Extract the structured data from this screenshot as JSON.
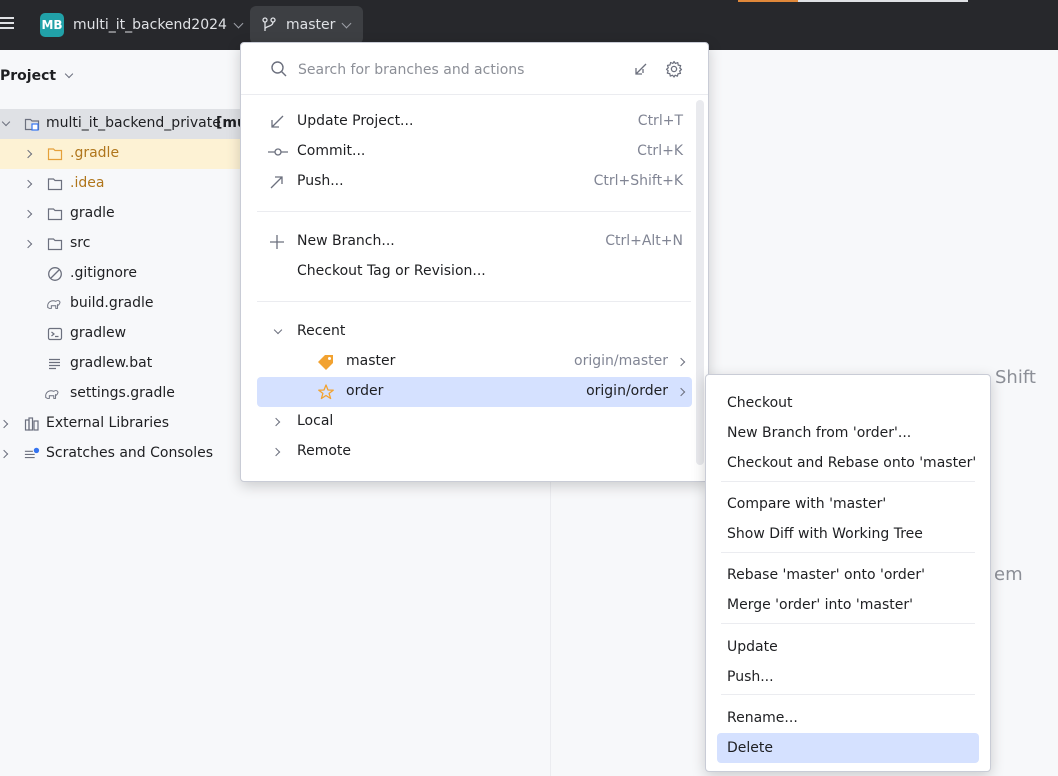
{
  "titlebar": {
    "project_badge": "MB",
    "project_name": "multi_it_backend2024",
    "branch": "master"
  },
  "project_panel": {
    "header": "Project",
    "tree": [
      {
        "label": "multi_it_backend_private",
        "suffix": "[mu",
        "type": "module",
        "expanded": true
      },
      {
        "label": ".gradle",
        "type": "folder-orange",
        "expanded": false
      },
      {
        "label": ".idea",
        "type": "folder",
        "expanded": false
      },
      {
        "label": "gradle",
        "type": "folder",
        "expanded": false
      },
      {
        "label": "src",
        "type": "folder",
        "expanded": false
      },
      {
        "label": ".gitignore",
        "type": "ignore-file"
      },
      {
        "label": "build.gradle",
        "type": "gradle-file"
      },
      {
        "label": "gradlew",
        "type": "shell-file"
      },
      {
        "label": "gradlew.bat",
        "type": "text-file"
      },
      {
        "label": "settings.gradle",
        "type": "gradle-file"
      },
      {
        "label": "External Libraries",
        "type": "library",
        "expanded": false
      },
      {
        "label": "Scratches and Consoles",
        "type": "scratches",
        "expanded": false
      }
    ]
  },
  "background_hints": {
    "hint1": "Shift",
    "hint2": "em"
  },
  "branch_popup": {
    "search_placeholder": "Search for branches and actions",
    "actions": [
      {
        "label": "Update Project...",
        "shortcut": "Ctrl+T",
        "icon": "update-arrow-icon"
      },
      {
        "label": "Commit...",
        "shortcut": "Ctrl+K",
        "icon": "commit-icon"
      },
      {
        "label": "Push...",
        "shortcut": "Ctrl+Shift+K",
        "icon": "push-arrow-icon"
      }
    ],
    "branch_actions": [
      {
        "label": "New Branch...",
        "shortcut": "Ctrl+Alt+N",
        "icon": "plus-icon"
      },
      {
        "label": "Checkout Tag or Revision...",
        "shortcut": ""
      }
    ],
    "groups": {
      "recent": "Recent",
      "local": "Local",
      "remote": "Remote"
    },
    "recent_branches": [
      {
        "name": "master",
        "remote": "origin/master",
        "icon": "tag-icon"
      },
      {
        "name": "order",
        "remote": "origin/order",
        "icon": "star-icon"
      }
    ]
  },
  "context_menu": {
    "items": [
      "Checkout",
      "New Branch from 'order'...",
      "Checkout and Rebase onto 'master'",
      "Compare with 'master'",
      "Show Diff with Working Tree",
      "Rebase 'master' onto 'order'",
      "Merge 'order' into 'master'",
      "Update",
      "Push...",
      "Rename...",
      "Delete"
    ],
    "selected": "Delete"
  },
  "colors": {
    "titlebar_bg": "#27282c",
    "selection_bg": "#d5e1ff",
    "highlight_row": "#fdf2d4",
    "tag_orange": "#f2a230",
    "star_orange": "#f2a230"
  }
}
